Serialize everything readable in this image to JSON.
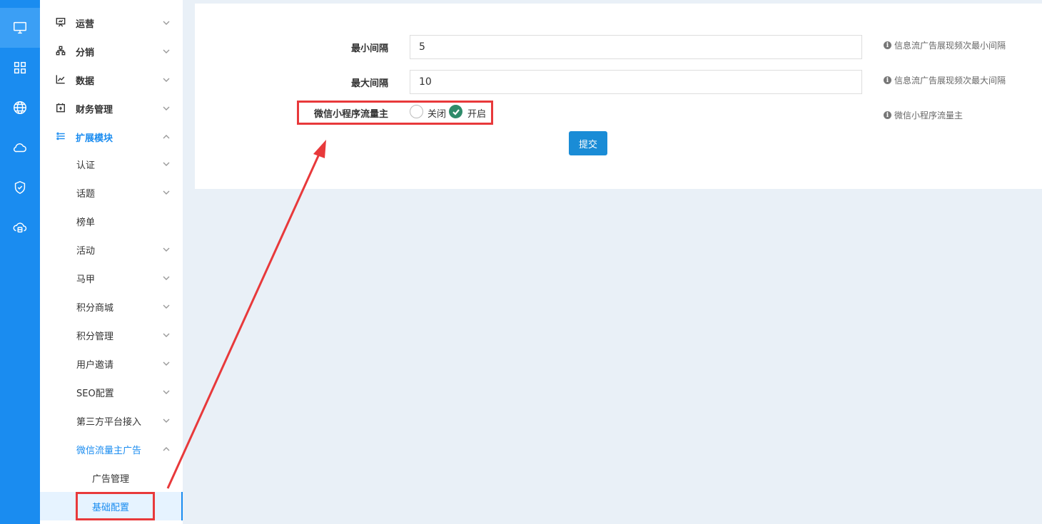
{
  "rail": {
    "icons": [
      "monitor-icon",
      "grid-icon",
      "globe-icon",
      "cloud-icon",
      "shield-check-icon",
      "cloud-server-icon"
    ]
  },
  "sidebar": {
    "top_items": [
      {
        "label": "运营",
        "icon": "presentation-icon"
      },
      {
        "label": "分销",
        "icon": "hierarchy-icon"
      },
      {
        "label": "数据",
        "icon": "line-chart-icon"
      },
      {
        "label": "财务管理",
        "icon": "calendar-icon"
      },
      {
        "label": "扩展模块",
        "icon": "sliders-icon"
      }
    ],
    "sub_items": [
      "认证",
      "话题",
      "榜单",
      "活动",
      "马甲",
      "积分商城",
      "积分管理",
      "用户邀请",
      "SEO配置",
      "第三方平台接入",
      "微信流量主广告"
    ],
    "sub2_items": [
      "广告管理",
      "基础配置"
    ]
  },
  "form": {
    "min_interval": {
      "label": "最小间隔",
      "value": "5",
      "hint": "信息流广告展现频次最小间隔"
    },
    "max_interval": {
      "label": "最大间隔",
      "value": "10",
      "hint": "信息流广告展现频次最大间隔"
    },
    "wechat_traffic": {
      "label": "微信小程序流量主",
      "option_off": "关闭",
      "option_on": "开启",
      "selected": "开启",
      "hint": "微信小程序流量主"
    },
    "submit_label": "提交"
  },
  "annotation": {
    "color": "#e8393b"
  }
}
